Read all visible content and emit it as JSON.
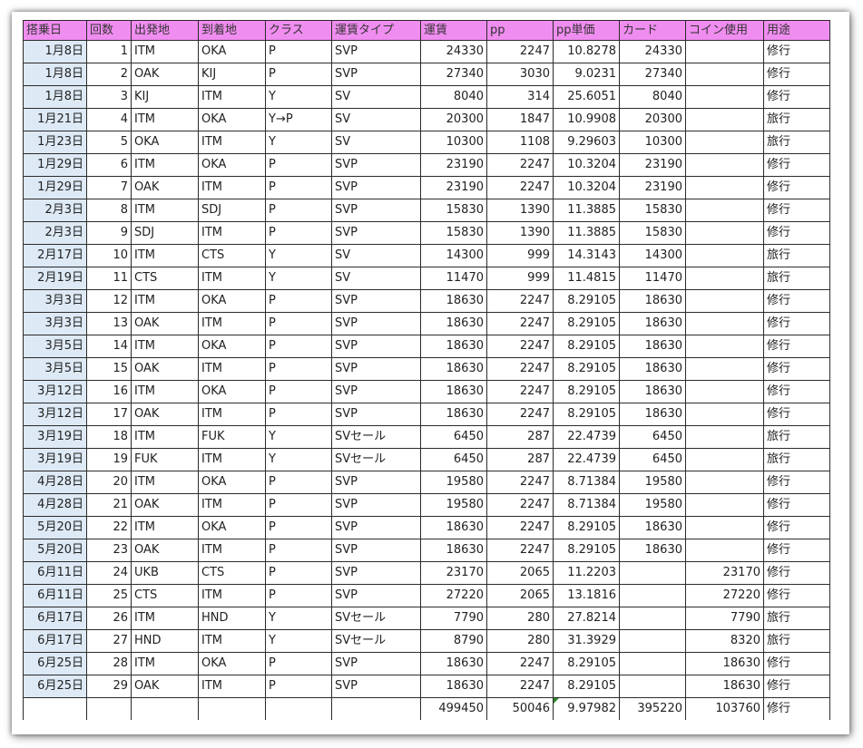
{
  "headers": [
    "搭乗日",
    "回数",
    "出発地",
    "到着地",
    "クラス",
    "運賃タイプ",
    "運賃",
    "pp",
    "pp単価",
    "カード",
    "コイン使用",
    "用途"
  ],
  "rows": [
    [
      "1月8日",
      "1",
      "ITM",
      "OKA",
      "P",
      "SVP",
      "24330",
      "2247",
      "10.8278",
      "24330",
      "",
      "修行"
    ],
    [
      "1月8日",
      "2",
      "OAK",
      "KIJ",
      "P",
      "SVP",
      "27340",
      "3030",
      "9.0231",
      "27340",
      "",
      "修行"
    ],
    [
      "1月8日",
      "3",
      "KIJ",
      "ITM",
      "Y",
      "SV",
      "8040",
      "314",
      "25.6051",
      "8040",
      "",
      "修行"
    ],
    [
      "1月21日",
      "4",
      "ITM",
      "OKA",
      "Y→P",
      "SV",
      "20300",
      "1847",
      "10.9908",
      "20300",
      "",
      "旅行"
    ],
    [
      "1月23日",
      "5",
      "OKA",
      "ITM",
      "Y",
      "SV",
      "10300",
      "1108",
      "9.29603",
      "10300",
      "",
      "旅行"
    ],
    [
      "1月29日",
      "6",
      "ITM",
      "OKA",
      "P",
      "SVP",
      "23190",
      "2247",
      "10.3204",
      "23190",
      "",
      "修行"
    ],
    [
      "1月29日",
      "7",
      "OAK",
      "ITM",
      "P",
      "SVP",
      "23190",
      "2247",
      "10.3204",
      "23190",
      "",
      "修行"
    ],
    [
      "2月3日",
      "8",
      "ITM",
      "SDJ",
      "P",
      "SVP",
      "15830",
      "1390",
      "11.3885",
      "15830",
      "",
      "修行"
    ],
    [
      "2月3日",
      "9",
      "SDJ",
      "ITM",
      "P",
      "SVP",
      "15830",
      "1390",
      "11.3885",
      "15830",
      "",
      "修行"
    ],
    [
      "2月17日",
      "10",
      "ITM",
      "CTS",
      "Y",
      "SV",
      "14300",
      "999",
      "14.3143",
      "14300",
      "",
      "旅行"
    ],
    [
      "2月19日",
      "11",
      "CTS",
      "ITM",
      "Y",
      "SV",
      "11470",
      "999",
      "11.4815",
      "11470",
      "",
      "旅行"
    ],
    [
      "3月3日",
      "12",
      "ITM",
      "OKA",
      "P",
      "SVP",
      "18630",
      "2247",
      "8.29105",
      "18630",
      "",
      "修行"
    ],
    [
      "3月3日",
      "13",
      "OAK",
      "ITM",
      "P",
      "SVP",
      "18630",
      "2247",
      "8.29105",
      "18630",
      "",
      "修行"
    ],
    [
      "3月5日",
      "14",
      "ITM",
      "OKA",
      "P",
      "SVP",
      "18630",
      "2247",
      "8.29105",
      "18630",
      "",
      "修行"
    ],
    [
      "3月5日",
      "15",
      "OAK",
      "ITM",
      "P",
      "SVP",
      "18630",
      "2247",
      "8.29105",
      "18630",
      "",
      "修行"
    ],
    [
      "3月12日",
      "16",
      "ITM",
      "OKA",
      "P",
      "SVP",
      "18630",
      "2247",
      "8.29105",
      "18630",
      "",
      "修行"
    ],
    [
      "3月12日",
      "17",
      "OAK",
      "ITM",
      "P",
      "SVP",
      "18630",
      "2247",
      "8.29105",
      "18630",
      "",
      "修行"
    ],
    [
      "3月19日",
      "18",
      "ITM",
      "FUK",
      "Y",
      "SVセール",
      "6450",
      "287",
      "22.4739",
      "6450",
      "",
      "旅行"
    ],
    [
      "3月19日",
      "19",
      "FUK",
      "ITM",
      "Y",
      "SVセール",
      "6450",
      "287",
      "22.4739",
      "6450",
      "",
      "旅行"
    ],
    [
      "4月28日",
      "20",
      "ITM",
      "OKA",
      "P",
      "SVP",
      "19580",
      "2247",
      "8.71384",
      "19580",
      "",
      "修行"
    ],
    [
      "4月28日",
      "21",
      "OAK",
      "ITM",
      "P",
      "SVP",
      "19580",
      "2247",
      "8.71384",
      "19580",
      "",
      "修行"
    ],
    [
      "5月20日",
      "22",
      "ITM",
      "OKA",
      "P",
      "SVP",
      "18630",
      "2247",
      "8.29105",
      "18630",
      "",
      "修行"
    ],
    [
      "5月20日",
      "23",
      "OAK",
      "ITM",
      "P",
      "SVP",
      "18630",
      "2247",
      "8.29105",
      "18630",
      "",
      "修行"
    ],
    [
      "6月11日",
      "24",
      "UKB",
      "CTS",
      "P",
      "SVP",
      "23170",
      "2065",
      "11.2203",
      "",
      "23170",
      "修行"
    ],
    [
      "6月11日",
      "25",
      "CTS",
      "ITM",
      "P",
      "SVP",
      "27220",
      "2065",
      "13.1816",
      "",
      "27220",
      "修行"
    ],
    [
      "6月17日",
      "26",
      "ITM",
      "HND",
      "Y",
      "SVセール",
      "7790",
      "280",
      "27.8214",
      "",
      "7790",
      "旅行"
    ],
    [
      "6月17日",
      "27",
      "HND",
      "ITM",
      "Y",
      "SVセール",
      "8790",
      "280",
      "31.3929",
      "",
      "8320",
      "旅行"
    ],
    [
      "6月25日",
      "28",
      "ITM",
      "OKA",
      "P",
      "SVP",
      "18630",
      "2247",
      "8.29105",
      "",
      "18630",
      "修行"
    ],
    [
      "6月25日",
      "29",
      "OAK",
      "ITM",
      "P",
      "SVP",
      "18630",
      "2247",
      "8.29105",
      "",
      "18630",
      "修行"
    ]
  ],
  "totals": [
    "",
    "",
    "",
    "",
    "",
    "",
    "499450",
    "50046",
    "9.97982",
    "395220",
    "103760",
    "修行"
  ]
}
